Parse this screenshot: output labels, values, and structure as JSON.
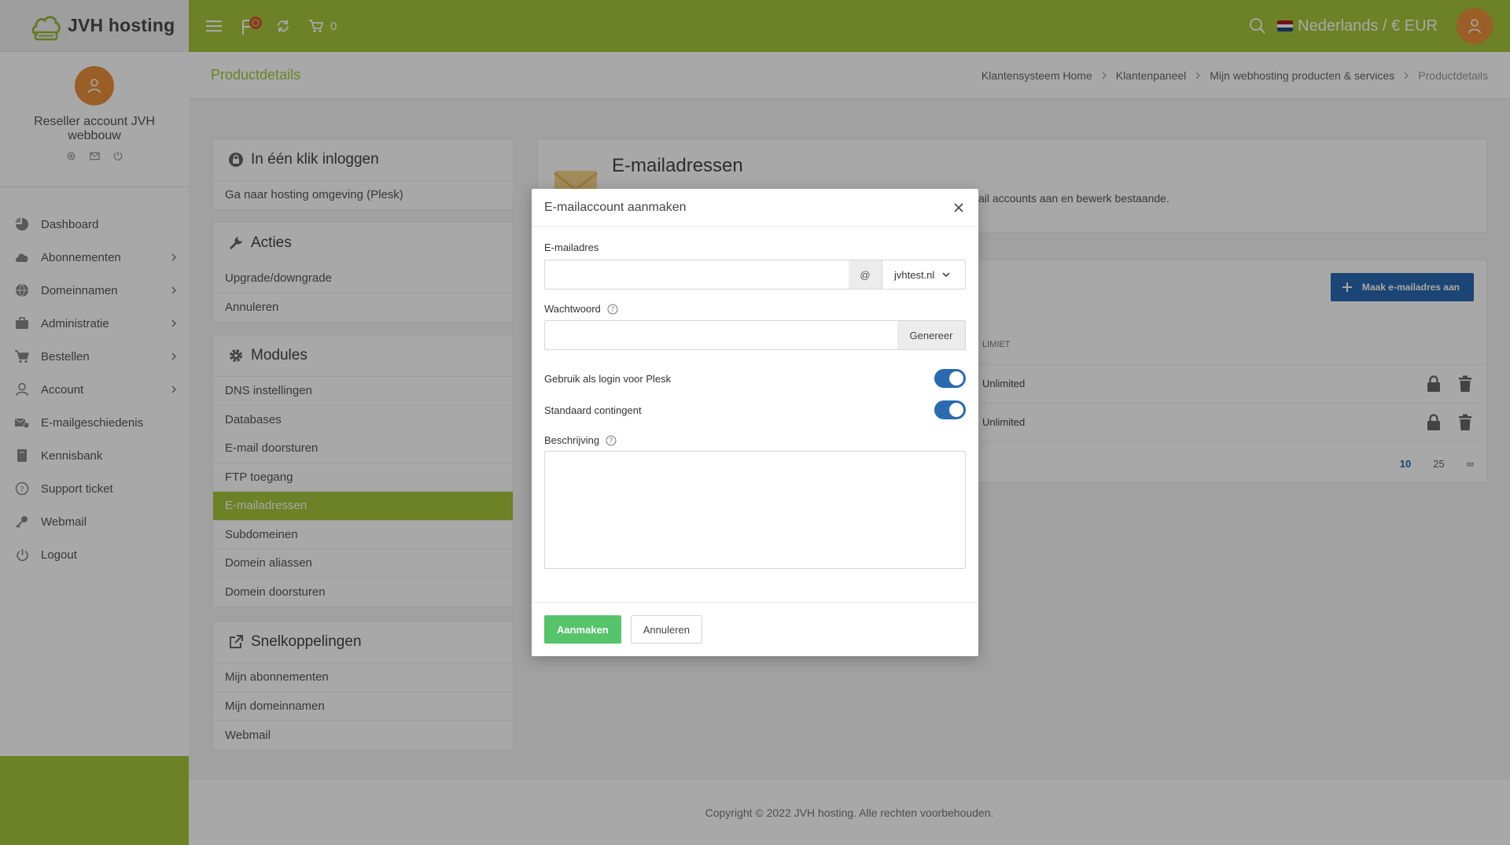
{
  "brand": {
    "name": "JVH hosting"
  },
  "profile": {
    "name": "Reseller account JVH webbouw"
  },
  "nav": [
    {
      "label": "Dashboard",
      "icon": "dashboard-icon",
      "chevron": false
    },
    {
      "label": "Abonnementen",
      "icon": "cloud-icon",
      "chevron": true
    },
    {
      "label": "Domeinnamen",
      "icon": "globe-icon",
      "chevron": true
    },
    {
      "label": "Administratie",
      "icon": "briefcase-icon",
      "chevron": true
    },
    {
      "label": "Bestellen",
      "icon": "cart-icon",
      "chevron": true
    },
    {
      "label": "Account",
      "icon": "user-icon",
      "chevron": true
    },
    {
      "label": "E-mailgeschiedenis",
      "icon": "mail-history-icon",
      "chevron": false
    },
    {
      "label": "Kennisbank",
      "icon": "book-icon",
      "chevron": false
    },
    {
      "label": "Support ticket",
      "icon": "help-icon",
      "chevron": false
    },
    {
      "label": "Webmail",
      "icon": "key-icon",
      "chevron": false
    },
    {
      "label": "Logout",
      "icon": "power-icon",
      "chevron": false
    }
  ],
  "topbar": {
    "cart_count": "0",
    "language": "Nederlands / € EUR"
  },
  "page": {
    "title": "Productdetails",
    "breadcrumb": [
      "Klantensysteem Home",
      "Klantenpaneel",
      "Mijn webhosting producten & services",
      "Productdetails"
    ]
  },
  "panels": {
    "login": {
      "title": "In één klik inloggen",
      "items": [
        "Ga naar hosting omgeving (Plesk)"
      ]
    },
    "actions": {
      "title": "Acties",
      "items": [
        "Upgrade/downgrade",
        "Annuleren"
      ]
    },
    "modules": {
      "title": "Modules",
      "items": [
        "DNS instellingen",
        "Databases",
        "E-mail doorsturen",
        "FTP toegang",
        "E-mailadressen",
        "Subdomeinen",
        "Domein aliassen",
        "Domein doorsturen"
      ],
      "active": "E-mailadressen"
    },
    "shortcuts": {
      "title": "Snelkoppelingen",
      "items": [
        "Mijn abonnementen",
        "Mijn domeinnamen",
        "Webmail"
      ]
    }
  },
  "email_section": {
    "title": "E-mailadressen",
    "description": "ail accounts aan en bewerk bestaande.",
    "create_button": "Maak e-mailadres aan",
    "column_limit": "LIMIET",
    "rows": [
      {
        "limit": "Unlimited"
      },
      {
        "limit": "Unlimited"
      }
    ],
    "pager": [
      "10",
      "25",
      "∞"
    ]
  },
  "footer": {
    "text": "Copyright © 2022 JVH hosting. Alle rechten voorbehouden."
  },
  "modal": {
    "title": "E-mailaccount aanmaken",
    "email_label": "E-mailadres",
    "email_value": "",
    "at_sign": "@",
    "domain": "jvhtest.nl",
    "password_label": "Wachtwoord",
    "password_value": "",
    "generate_button": "Genereer",
    "plesk_login_label": "Gebruik als login voor Plesk",
    "plesk_login_on": true,
    "quota_label": "Standaard contingent",
    "quota_on": true,
    "description_label": "Beschrijving",
    "description_value": "",
    "create_button": "Aanmaken",
    "cancel_button": "Annuleren"
  },
  "colors": {
    "brand_green": "#a6c43a",
    "accent_blue": "#2a6ab0",
    "orange": "#e8903a",
    "success": "#55c46a"
  }
}
